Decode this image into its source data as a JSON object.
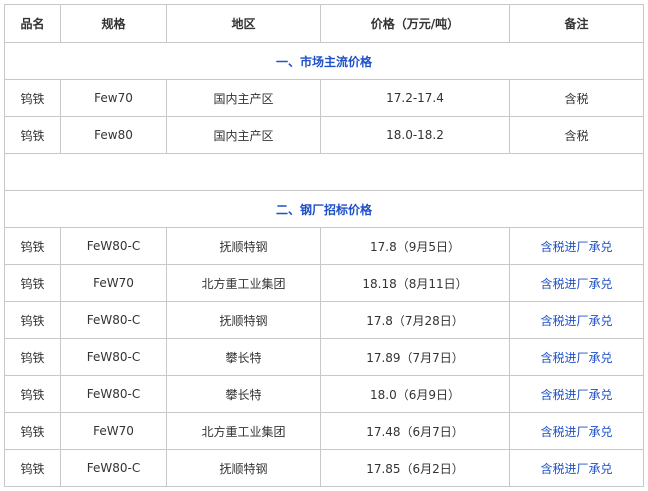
{
  "headers": [
    "品名",
    "规格",
    "地区",
    "价格（万元/吨）",
    "备注"
  ],
  "section1_title": "一、市场主流价格",
  "section1_rows": [
    [
      "钨铁",
      "Few70",
      "国内主产区",
      "17.2-17.4",
      "含税"
    ],
    [
      "钨铁",
      "Few80",
      "国内主产区",
      "18.0-18.2",
      "含税"
    ]
  ],
  "section2_title": "二、钢厂招标价格",
  "section2_rows": [
    [
      "钨铁",
      "FeW80-C",
      "抚顺特钢",
      "17.8（9月5日）",
      "含税进厂承兑"
    ],
    [
      "钨铁",
      "FeW70",
      "北方重工业集团",
      "18.18（8月11日）",
      "含税进厂承兑"
    ],
    [
      "钨铁",
      "FeW80-C",
      "抚顺特钢",
      "17.8（7月28日）",
      "含税进厂承兑"
    ],
    [
      "钨铁",
      "FeW80-C",
      "攀长特",
      "17.89（7月7日）",
      "含税进厂承兑"
    ],
    [
      "钨铁",
      "FeW80-C",
      "攀长特",
      "18.0（6月9日）",
      "含税进厂承兑"
    ],
    [
      "钨铁",
      "FeW70",
      "北方重工业集团",
      "17.48（6月7日）",
      "含税进厂承兑"
    ],
    [
      "钨铁",
      "FeW80-C",
      "抚顺特钢",
      "17.85（6月2日）",
      "含税进厂承兑"
    ]
  ]
}
